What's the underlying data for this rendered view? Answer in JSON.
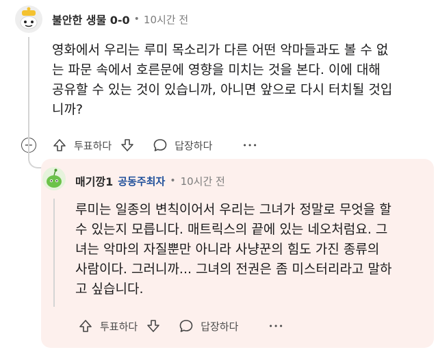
{
  "parent_comment": {
    "username": "불안한 생물 0-0",
    "separator": "•",
    "time": "10시간 전",
    "body_lines": [
      "영화에서 우리는 루미 목소리가 다른 어떤 악마들과도 볼 수 없",
      "는 파문 속에서 호른문에 영향을 미치는 것을 본다. 이에 대해",
      "공유할 수 있는 것이 있습니까, 아니면 앞으로 다시 터치될 것입",
      "니까?"
    ],
    "actions": {
      "vote_label": "투표하다",
      "reply_label": "답장하다",
      "more_label": "•••",
      "collapse_symbol": "−"
    }
  },
  "reply_comment": {
    "username": "매기깡1",
    "flair": "공동주최자",
    "separator": "•",
    "time": "10시간 전",
    "body_lines": [
      "루미는 일종의 변칙이어서 우리는 그녀가 정말로 무엇을 할",
      "수 있는지 모릅니다. 매트릭스의 끝에 있는 네오처럼요. 그",
      "녀는 악마의 자질뿐만 아니라 사냥꾼의 힘도 가진 종류의",
      "사람이다. 그러니까... 그녀의 전권은 좀 미스터리라고 말하",
      "고 싶습니다."
    ],
    "actions": {
      "vote_label": "투표하다",
      "reply_label": "답장하다",
      "more_label": "•••"
    }
  },
  "colors": {
    "reply_background": "#fdf0ed",
    "flair_text": "#1f4f9a",
    "meta_text": "#7c7c7c",
    "thread_line": "#d4d4d4"
  },
  "icons": [
    "snoo-avatar-yellow",
    "snoo-avatar-green",
    "collapse-icon",
    "upvote-icon",
    "downvote-icon",
    "comment-bubble-icon",
    "more-options-icon"
  ]
}
